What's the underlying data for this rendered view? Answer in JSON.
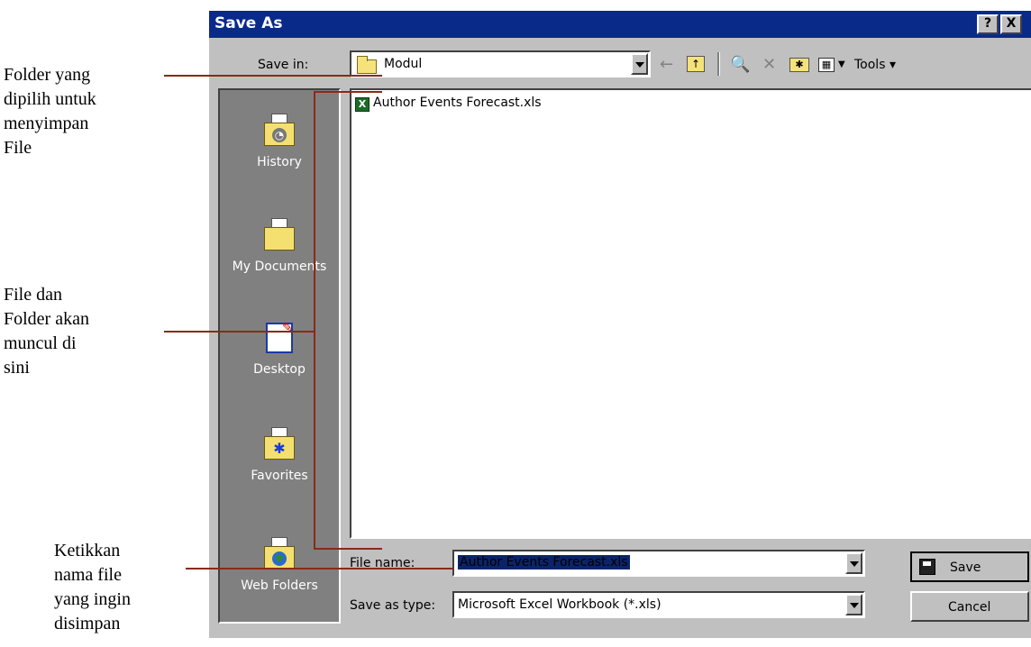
{
  "annotations": {
    "folder": [
      "Folder yang",
      "dipilih untuk",
      "menyimpan",
      "File"
    ],
    "files": [
      "File dan",
      "Folder akan",
      "muncul di",
      "sini"
    ],
    "filename": [
      "Ketikkan",
      "nama file",
      "yang ingin",
      "disimpan"
    ]
  },
  "dialog": {
    "title": "Save As",
    "help_button": "?",
    "close_button": "X",
    "save_in_label": "Save in:",
    "save_in_value": "Modul",
    "tools_label": "Tools",
    "places": [
      "History",
      "My Documents",
      "Desktop",
      "Favorites",
      "Web Folders"
    ],
    "files": [
      {
        "name": "Author Events Forecast.xls",
        "icon": "excel-file-icon"
      }
    ],
    "file_name_label": "File name:",
    "file_name_value": "Author Events Forecast.xls",
    "save_type_label": "Save as type:",
    "save_type_value": "Microsoft Excel Workbook (*.xls)",
    "save_button": "Save",
    "cancel_button": "Cancel"
  },
  "colors": {
    "titlebar": "#0a2a8a",
    "leader_lines": "#8b2a16",
    "dialog_bg": "#c0c0c0"
  }
}
